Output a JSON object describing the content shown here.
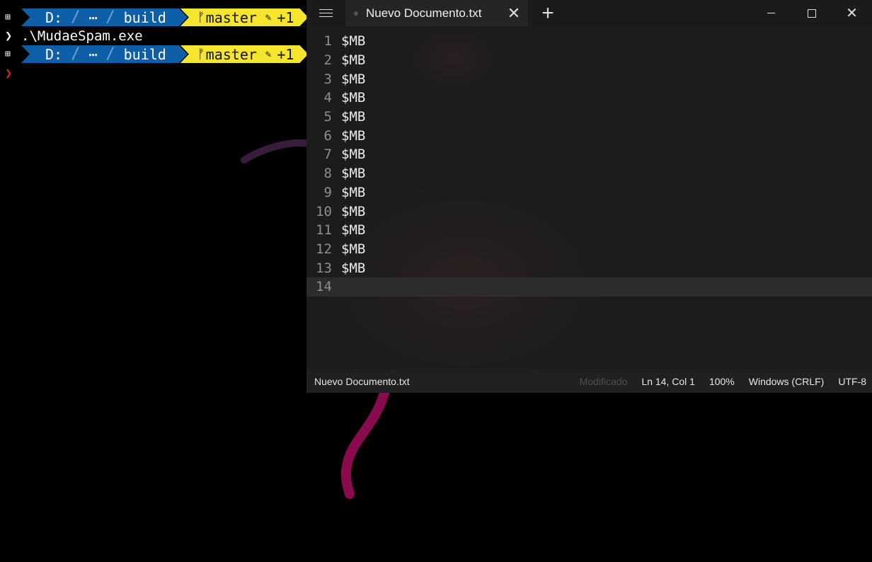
{
  "terminal": {
    "prompt": {
      "os_icon": "windows-icon",
      "drive": "D:",
      "ellipsis": "⋯",
      "folder": "build",
      "branch_icon": "git-branch-icon",
      "branch": "master",
      "edit_icon": "pencil-icon",
      "changes": "+1"
    },
    "command": ".\\MudaeSpam.exe",
    "chevron": "❯",
    "colors": {
      "segment_blue": "#0f5fa8",
      "segment_yellow": "#f5e52c",
      "error_chevron": "#d0262b"
    }
  },
  "editor": {
    "menu_icon": "hamburger-icon",
    "tab_title": "Nuevo Documento.txt",
    "close_tab_glyph": "✕",
    "new_tab_glyph": "+",
    "lines": [
      {
        "n": "1",
        "text": "$MB"
      },
      {
        "n": "2",
        "text": "$MB"
      },
      {
        "n": "3",
        "text": "$MB"
      },
      {
        "n": "4",
        "text": "$MB"
      },
      {
        "n": "5",
        "text": "$MB"
      },
      {
        "n": "6",
        "text": "$MB"
      },
      {
        "n": "7",
        "text": "$MB"
      },
      {
        "n": "8",
        "text": "$MB"
      },
      {
        "n": "9",
        "text": "$MB"
      },
      {
        "n": "10",
        "text": "$MB"
      },
      {
        "n": "11",
        "text": "$MB"
      },
      {
        "n": "12",
        "text": "$MB"
      },
      {
        "n": "13",
        "text": "$MB"
      },
      {
        "n": "14",
        "text": ""
      }
    ],
    "status": {
      "file": "Nuevo Documento.txt",
      "modified": "Modificado",
      "position": "Ln 14, Col 1",
      "zoom": "100%",
      "line_ending": "Windows (CRLF)",
      "encoding": "UTF-8"
    }
  }
}
